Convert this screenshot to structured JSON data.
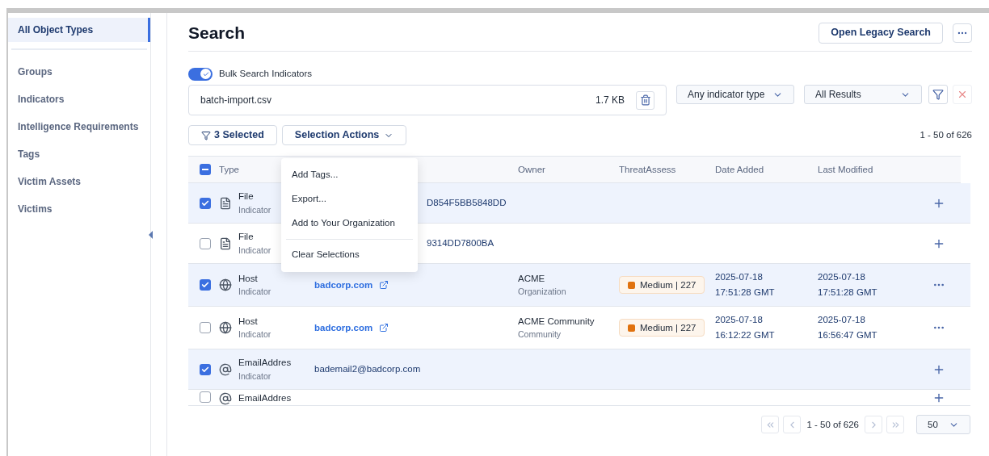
{
  "sidebar": {
    "items": [
      {
        "label": "All Object Types",
        "selected": true
      },
      {
        "label": "Groups",
        "selected": false
      },
      {
        "label": "Indicators",
        "selected": false
      },
      {
        "label": "Intelligence Requirements",
        "selected": false
      },
      {
        "label": "Tags",
        "selected": false
      },
      {
        "label": "Victim Assets",
        "selected": false
      },
      {
        "label": "Victims",
        "selected": false
      }
    ]
  },
  "header": {
    "title": "Search",
    "legacy_button": "Open Legacy Search"
  },
  "bulk": {
    "label": "Bulk Search Indicators",
    "on": true
  },
  "file": {
    "name": "batch-import.csv",
    "size": "1.7 KB"
  },
  "filters": [
    {
      "label": "Any indicator type"
    },
    {
      "label": "All Results"
    }
  ],
  "selected_button": "3 Selected",
  "actions_button": "Selection Actions",
  "range": "1 - 50 of 626",
  "menu": {
    "items": [
      "Add Tags...",
      "Export...",
      "Add to Your Organization"
    ],
    "footer_item": "Clear Selections"
  },
  "table": {
    "header_partial": true,
    "columns": [
      "Type",
      "Owner",
      "ThreatAssess",
      "Date Added",
      "Last Modified"
    ],
    "rows": [
      {
        "kind": "hash",
        "checked": true,
        "type": "File",
        "sub": "Indicator",
        "summary": "D854F5BB5848DD",
        "actions_menu": false
      },
      {
        "kind": "hash",
        "checked": false,
        "type": "File",
        "sub": "Indicator",
        "summary": "9314DD7800BA",
        "actions_menu": false
      },
      {
        "kind": "url",
        "checked": true,
        "type": "Host",
        "sub": "Indicator",
        "summary": "badcorp.com",
        "owner": "ACME",
        "owner_sub": "Organization",
        "threat": "Medium | 227",
        "color": "#e0720f",
        "added": [
          "2025-07-18",
          "17:51:28 GMT"
        ],
        "modified": [
          "2025-07-18",
          "17:51:28 GMT"
        ],
        "actions_menu": true
      },
      {
        "kind": "url",
        "checked": false,
        "type": "Host",
        "sub": "Indicator",
        "summary": "badcorp.com",
        "owner": "ACME Community",
        "owner_sub": "Community",
        "threat": "Medium | 227",
        "color": "#e0720f",
        "added": [
          "2025-07-18",
          "16:12:22 GMT"
        ],
        "modified": [
          "2025-07-18",
          "16:56:47 GMT"
        ],
        "actions_menu": true
      },
      {
        "kind": "email",
        "checked": true,
        "type": "EmailAddres",
        "sub": "Indicator",
        "summary": "bademail2@badcorp.com",
        "actions_menu": false
      },
      {
        "kind": "email",
        "checked": false,
        "type": "EmailAddres",
        "actions_menu": false
      }
    ]
  },
  "pager": {
    "range": "1 - 50 of 626",
    "page_size": "50"
  }
}
